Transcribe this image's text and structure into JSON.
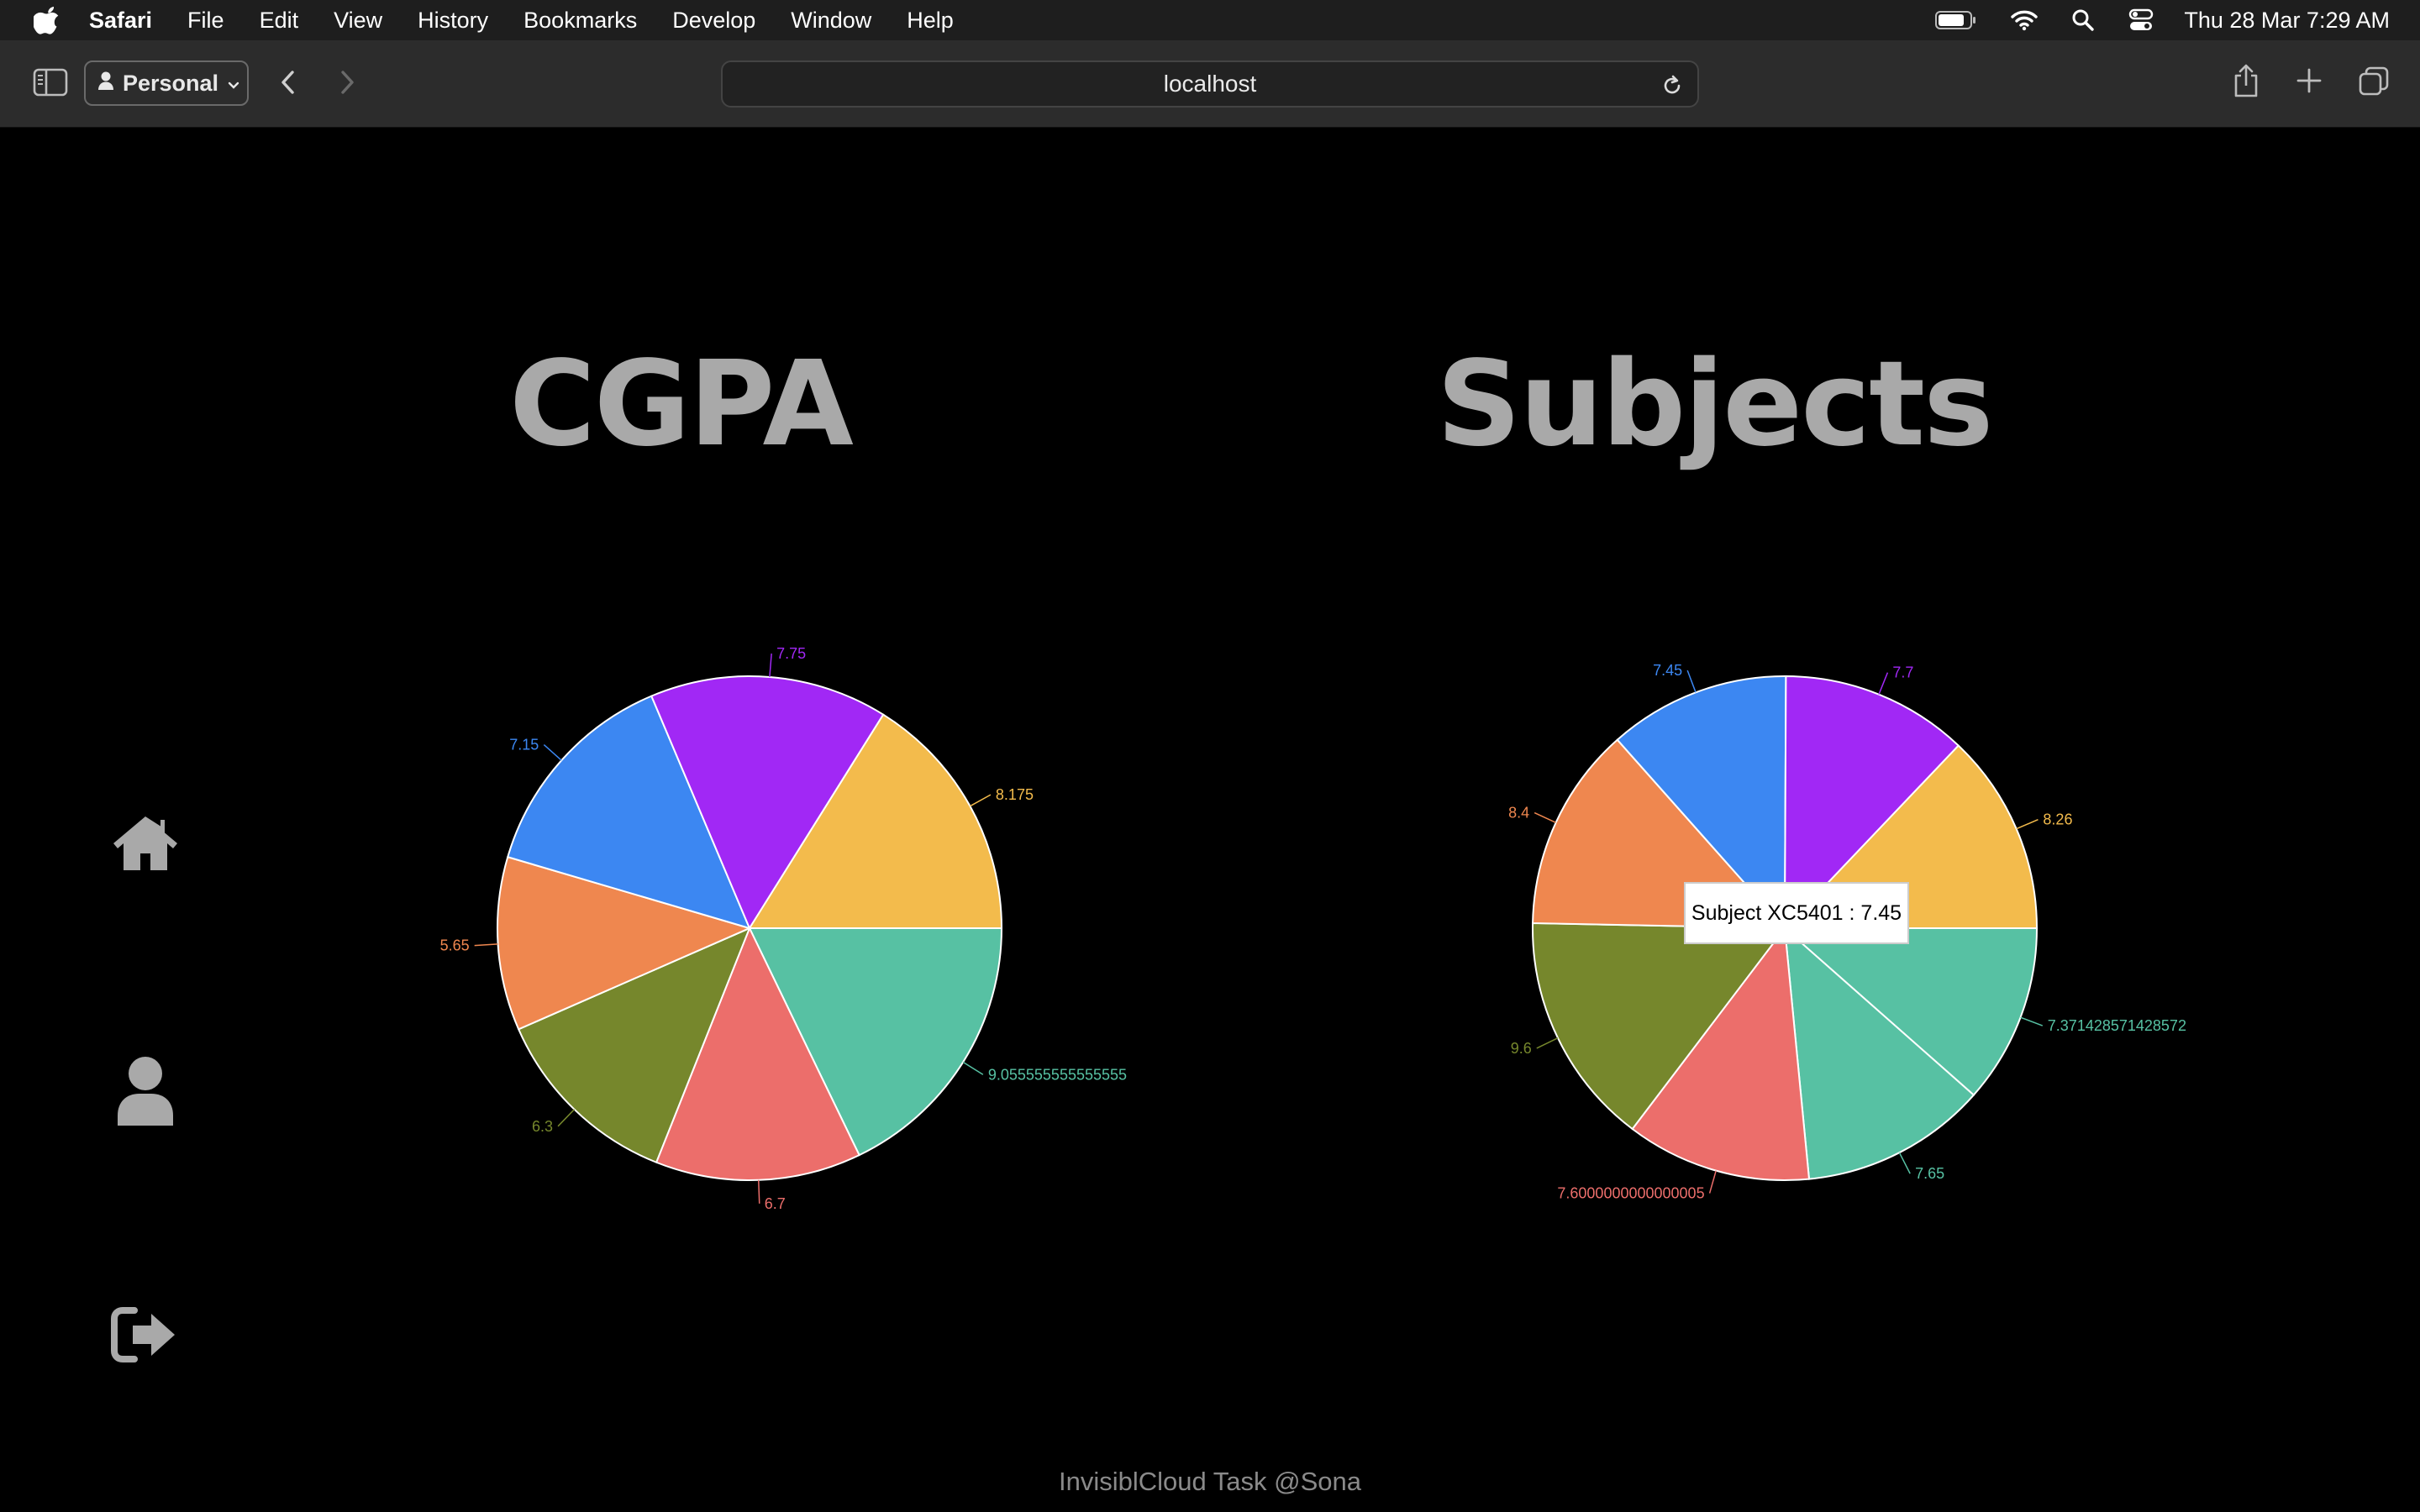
{
  "menubar": {
    "app_name": "Safari",
    "items": [
      "File",
      "Edit",
      "View",
      "History",
      "Bookmarks",
      "Develop",
      "Window",
      "Help"
    ],
    "clock": "Thu 28 Mar  7:29 AM"
  },
  "toolbar": {
    "profile_label": "Personal",
    "address": "localhost"
  },
  "side_nav": {
    "icons": [
      "home-icon",
      "user-icon",
      "logout-icon"
    ]
  },
  "cgpa": {
    "title": "CGPA"
  },
  "subjects": {
    "title": "Subjects",
    "tooltip": "Subject XC5401 : 7.45"
  },
  "footer": "InvisiblCloud Task @Sona",
  "colors": {
    "green": "#57c1a3",
    "red": "#ec6e6b",
    "olive": "#76872c",
    "orange": "#ef874f",
    "blue": "#3c87f2",
    "purple": "#a128f5",
    "yellow": "#f3bb4c"
  },
  "chart_data": [
    {
      "type": "pie",
      "title": "CGPA",
      "labels": [
        "9.055555555555555",
        "6.7",
        "6.3",
        "5.65",
        "7.15",
        "7.75",
        "8.175"
      ],
      "values": [
        9.055555555555555,
        6.7,
        6.3,
        5.65,
        7.15,
        7.75,
        8.175
      ],
      "colors": [
        "#57c1a3",
        "#ec6e6b",
        "#76872c",
        "#ef874f",
        "#3c87f2",
        "#a128f5",
        "#f3bb4c"
      ]
    },
    {
      "type": "pie",
      "title": "Subjects",
      "labels": [
        "7.371428571428572",
        "7.65",
        "7.6000000000000005",
        "9.6",
        "8.4",
        "7.45",
        "7.7",
        "8.26"
      ],
      "values": [
        7.371428571428572,
        7.65,
        7.6000000000000005,
        9.6,
        8.4,
        7.45,
        7.7,
        8.26
      ],
      "colors": [
        "#57c1a3",
        "#57c1a3",
        "#ec6e6b",
        "#76872c",
        "#ef874f",
        "#3c87f2",
        "#a128f5",
        "#f3bb4c"
      ]
    }
  ]
}
